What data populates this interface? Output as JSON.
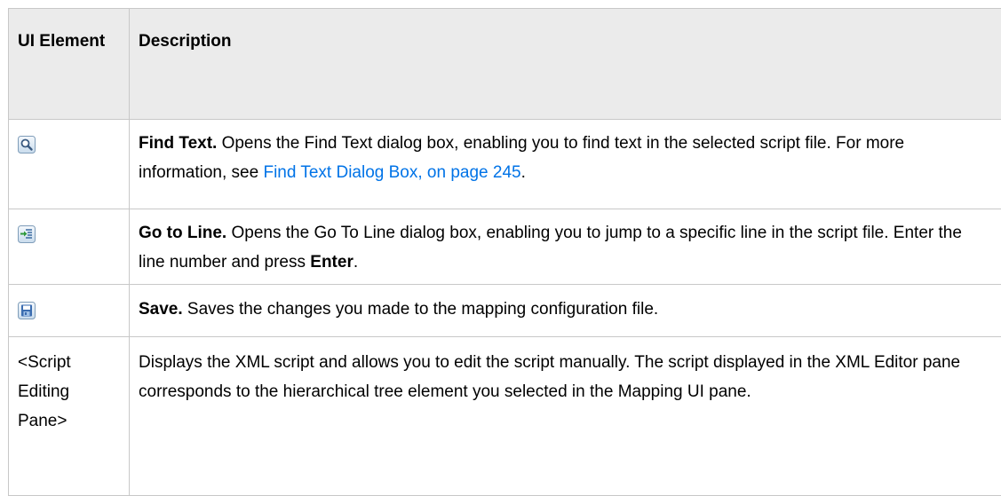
{
  "table": {
    "headers": {
      "element": "UI Element",
      "description": "Description"
    },
    "rows": [
      {
        "icon": "find-text-magnifier-icon",
        "name": "Find Text.",
        "text_before": " Opens the Find Text dialog box, enabling you to find text in the selected script file. For more information, see ",
        "link": "Find Text Dialog Box, on page 245",
        "text_after": "."
      },
      {
        "icon": "go-to-line-icon",
        "name": "Go to Line.",
        "text_before": " Opens the Go To Line dialog box, enabling you to jump to a specific line in the script file. Enter the line number and press ",
        "key": "Enter",
        "text_after": "."
      },
      {
        "icon": "save-floppy-icon",
        "name": "Save.",
        "text_before": " Saves the changes you made to the mapping configuration file."
      },
      {
        "element_label": "<Script Editing Pane>",
        "text": "Displays the XML script and allows you to edit the script manually. The script displayed in the XML Editor pane corresponds to the hierarchical tree element you selected in the Mapping UI pane."
      }
    ]
  },
  "colors": {
    "link": "#0073e7",
    "header_bg": "#ebebeb",
    "border": "#c8c8c8"
  }
}
